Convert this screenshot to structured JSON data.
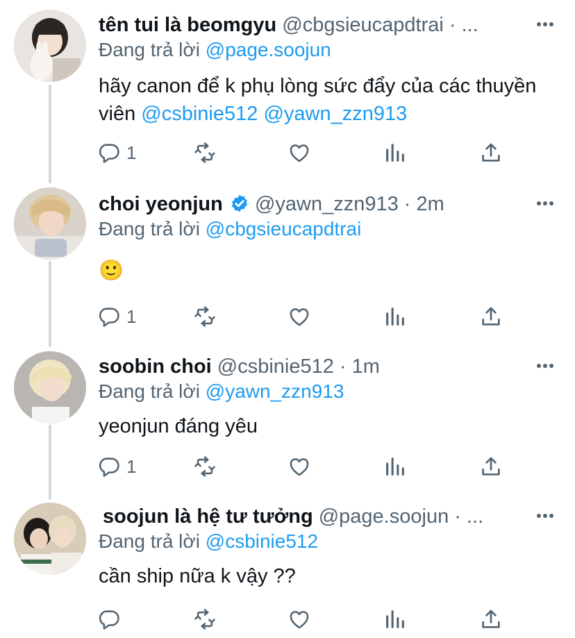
{
  "tweets": [
    {
      "name": "tên tui là beomgyu",
      "handle": "@cbgsieucapdtrai · ...",
      "reply_prefix": "Đang trả lời ",
      "reply_to": "@page.soojun",
      "text_plain": "hãy canon để k phụ lòng sức đẩy của các thuyền viên ",
      "text_mention_1": "@csbinie512",
      "text_mention_2": "@yawn_zzn913",
      "reply_count": "1",
      "verified": false
    },
    {
      "name": "choi yeonjun",
      "handle": "@yawn_zzn913 · 2m",
      "reply_prefix": "Đang trả lời ",
      "reply_to": "@cbgsieucapdtrai",
      "text_plain": "🙂",
      "reply_count": "1",
      "verified": true
    },
    {
      "name": "soobin choi",
      "handle": "@csbinie512 · 1m",
      "reply_prefix": "Đang trả lời ",
      "reply_to": "@yawn_zzn913",
      "text_plain": "yeonjun đáng yêu",
      "reply_count": "1",
      "verified": false
    },
    {
      "name": "soojun là hệ tư tưởng",
      "handle": "@page.soojun · ...",
      "reply_prefix": "Đang trả lời ",
      "reply_to": "@csbinie512",
      "text_plain": "cần ship nữa k vậy ??",
      "reply_count": "",
      "verified": false
    }
  ],
  "colors": {
    "accent": "#1d9bf0",
    "text_primary": "#0f1419",
    "text_secondary": "#536471",
    "thread_line": "#cfd9de"
  },
  "icons": [
    "reply-icon",
    "retweet-icon",
    "like-icon",
    "analytics-icon",
    "share-icon",
    "more-icon",
    "verified-badge-icon"
  ]
}
